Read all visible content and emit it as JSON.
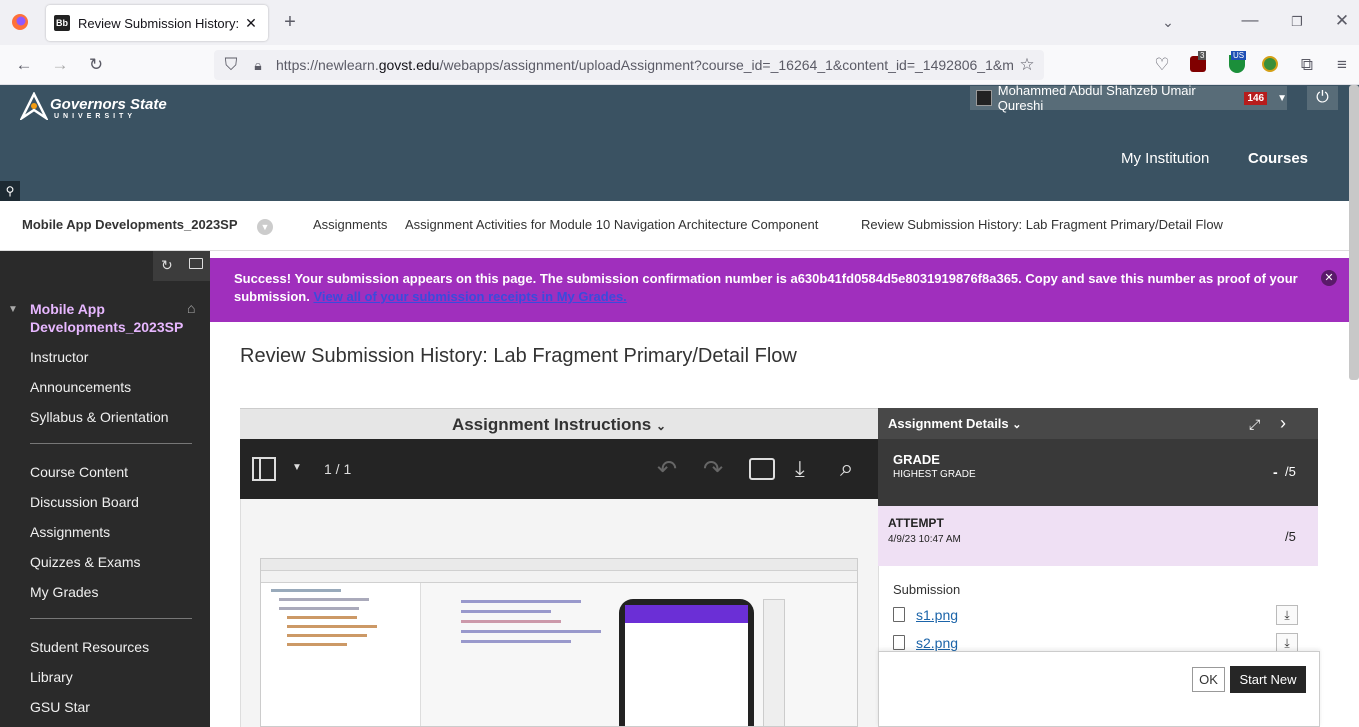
{
  "browser": {
    "tab_title": "Review Submission History: Lab Fragment Primary/Detail Flow",
    "tab_favicon": "Bb",
    "url_prefix": "https://newlearn.",
    "url_domain": "govst.edu",
    "url_path": "/webapps/assignment/uploadAssignment?course_id=_16264_1&content_id=_1492806_1&m",
    "ext_badge_count": "3",
    "ext_us_label": "US"
  },
  "site": {
    "logo_title": "Governors State",
    "logo_subtitle": "UNIVERSITY",
    "user_name": "Mohammed Abdul Shahzeb Umair Qureshi",
    "user_badge": "146",
    "nav": {
      "my_institution": "My Institution",
      "courses": "Courses"
    }
  },
  "breadcrumb": {
    "course": "Mobile App Developments_2023SP",
    "items": [
      "Assignments",
      "Assignment Activities for Module 10 Navigation Architecture Component",
      "Review Submission History: Lab Fragment Primary/Detail Flow"
    ]
  },
  "sidebar": {
    "course_title_line1": "Mobile App",
    "course_title_line2": "Developments_2023SP",
    "group1": [
      "Instructor",
      "Announcements",
      "Syllabus & Orientation"
    ],
    "group2": [
      "Course Content",
      "Discussion Board",
      "Assignments",
      "Quizzes & Exams",
      "My Grades"
    ],
    "group3": [
      "Student Resources",
      "Library",
      "GSU Star"
    ]
  },
  "alert": {
    "message": "Success! Your submission appears on this page. The submission confirmation number is a630b41fd0584d5e8031919876f8a365. Copy and save this number as proof of your submission.",
    "link": "View all of your submission receipts in My Grades."
  },
  "page": {
    "title": "Review Submission History: Lab Fragment Primary/Detail Flow"
  },
  "viewer": {
    "heading": "Assignment Instructions",
    "page_indicator": "1 / 1"
  },
  "details": {
    "heading": "Assignment Details",
    "grade_label": "GRADE",
    "grade_sub": "HIGHEST GRADE",
    "grade_value": "-",
    "grade_max": "/5",
    "attempt_label": "ATTEMPT",
    "attempt_date": "4/9/23 10:47 AM",
    "attempt_max": "/5",
    "submission_label": "Submission",
    "files": [
      "s1.png",
      "s2.png"
    ]
  },
  "actions": {
    "ok": "OK",
    "start_new": "Start New"
  },
  "colors": {
    "header": "#3a5262",
    "alert": "#a02fbd",
    "sidebar": "#2a2a2a"
  }
}
